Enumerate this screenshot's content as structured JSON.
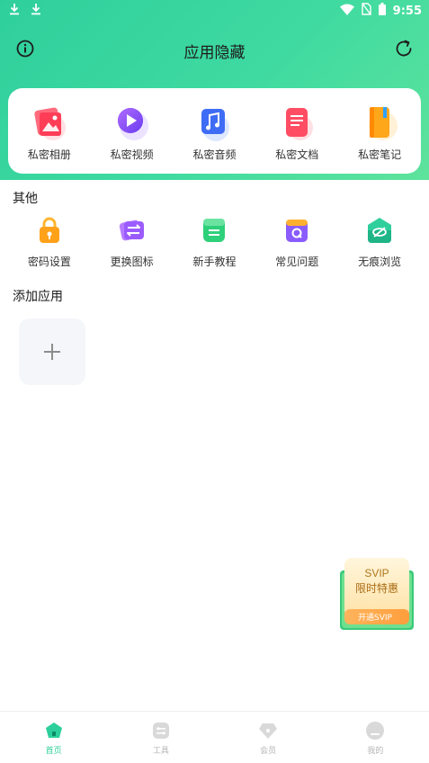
{
  "status": {
    "time": "9:55"
  },
  "header": {
    "title": "应用隐藏"
  },
  "private_items": [
    {
      "label": "私密相册",
      "icon": "photo-album-icon"
    },
    {
      "label": "私密视频",
      "icon": "video-icon"
    },
    {
      "label": "私密音频",
      "icon": "music-icon"
    },
    {
      "label": "私密文档",
      "icon": "document-icon"
    },
    {
      "label": "私密笔记",
      "icon": "notebook-icon"
    }
  ],
  "others": {
    "title": "其他",
    "items": [
      {
        "label": "密码设置",
        "icon": "lock-icon"
      },
      {
        "label": "更换图标",
        "icon": "swap-icon"
      },
      {
        "label": "新手教程",
        "icon": "tutorial-icon"
      },
      {
        "label": "常见问题",
        "icon": "faq-icon"
      },
      {
        "label": "无痕浏览",
        "icon": "incognito-eye-icon"
      }
    ]
  },
  "add_apps": {
    "title": "添加应用"
  },
  "promo": {
    "line1": "SVIP",
    "line2": "限时特惠",
    "button": "开通SVIP"
  },
  "tabs": [
    {
      "label": "首页",
      "icon": "home-icon",
      "active": true
    },
    {
      "label": "工具",
      "icon": "tools-icon",
      "active": false
    },
    {
      "label": "会员",
      "icon": "vip-diamond-icon",
      "active": false
    },
    {
      "label": "我的",
      "icon": "profile-icon",
      "active": false
    }
  ],
  "colors": {
    "accent": "#2ccf9a",
    "header_start": "#2fcf9c",
    "header_end": "#5ee39c"
  }
}
